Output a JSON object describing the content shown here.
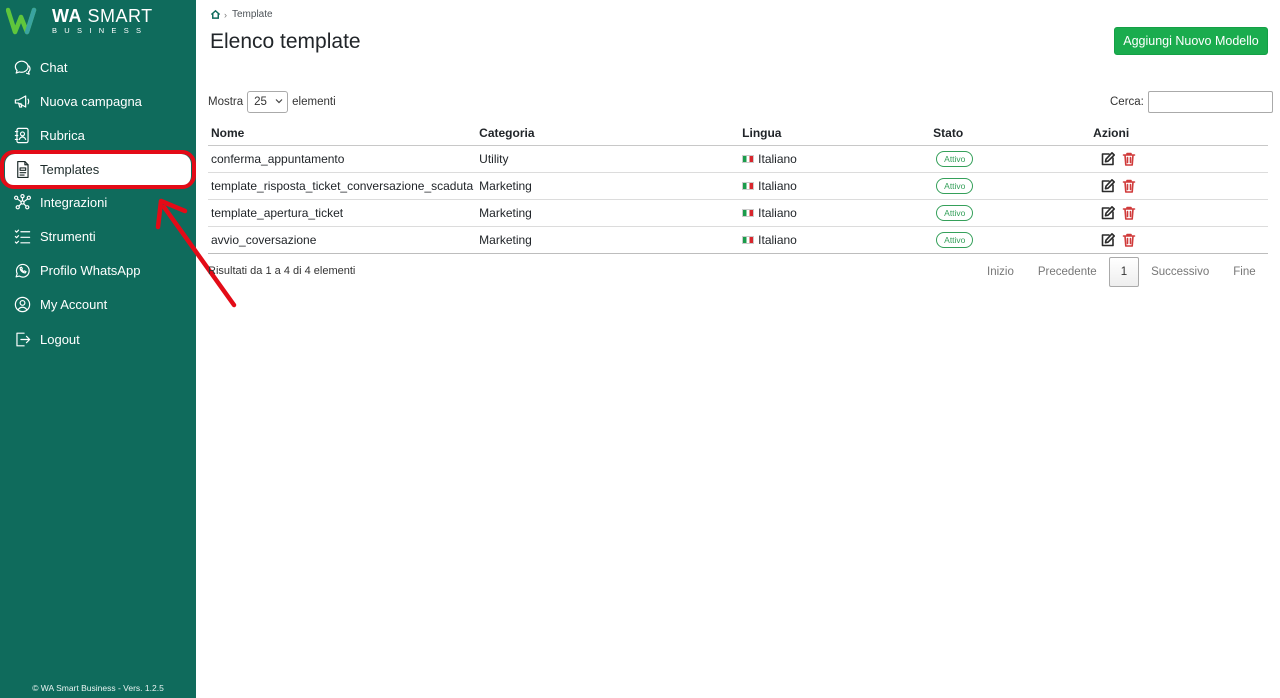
{
  "sidebar": {
    "brand_bold": "WA",
    "brand_rest": " SMART",
    "brand_sub": "BUSINESS",
    "items": [
      {
        "label": "Chat",
        "icon": "chat-icon"
      },
      {
        "label": "Nuova campagna",
        "icon": "megaphone-icon"
      },
      {
        "label": "Rubrica",
        "icon": "contacts-icon"
      },
      {
        "label": "Templates",
        "icon": "document-icon"
      },
      {
        "label": "Integrazioni",
        "icon": "network-icon"
      },
      {
        "label": "Strumenti",
        "icon": "checklist-icon"
      },
      {
        "label": "Profilo WhatsApp",
        "icon": "whatsapp-icon"
      },
      {
        "label": "My Account",
        "icon": "user-circle-icon"
      },
      {
        "label": "Logout",
        "icon": "logout-icon"
      }
    ],
    "active_item": "Templates",
    "footer": "© WA Smart Business - Vers. 1.2.5",
    "background_color": "#0f6b5c"
  },
  "breadcrumb": {
    "current": "Template"
  },
  "header": {
    "title": "Elenco template",
    "add_button": "Aggiungi Nuovo Modello",
    "add_button_color": "#1aac4e"
  },
  "controls": {
    "show_label": "Mostra",
    "page_length": "25",
    "entries_label": "elementi",
    "search_label": "Cerca:",
    "search_value": ""
  },
  "table": {
    "columns": [
      "Nome",
      "Categoria",
      "Lingua",
      "Stato",
      "Azioni"
    ],
    "rows": [
      {
        "name": "conferma_appuntamento",
        "category": "Utility",
        "language": "Italiano",
        "status": "Attivo"
      },
      {
        "name": "template_risposta_ticket_conversazione_scaduta",
        "category": "Marketing",
        "language": "Italiano",
        "status": "Attivo"
      },
      {
        "name": "template_apertura_ticket",
        "category": "Marketing",
        "language": "Italiano",
        "status": "Attivo"
      },
      {
        "name": "avvio_coversazione",
        "category": "Marketing",
        "language": "Italiano",
        "status": "Attivo"
      }
    ]
  },
  "footer": {
    "info": "Risultati da 1 a 4 di 4 elementi",
    "pagination": {
      "first": "Inizio",
      "previous": "Precedente",
      "current": "1",
      "next": "Successivo",
      "last": "Fine"
    }
  },
  "annotation": {
    "highlight_color": "#e30b17"
  }
}
